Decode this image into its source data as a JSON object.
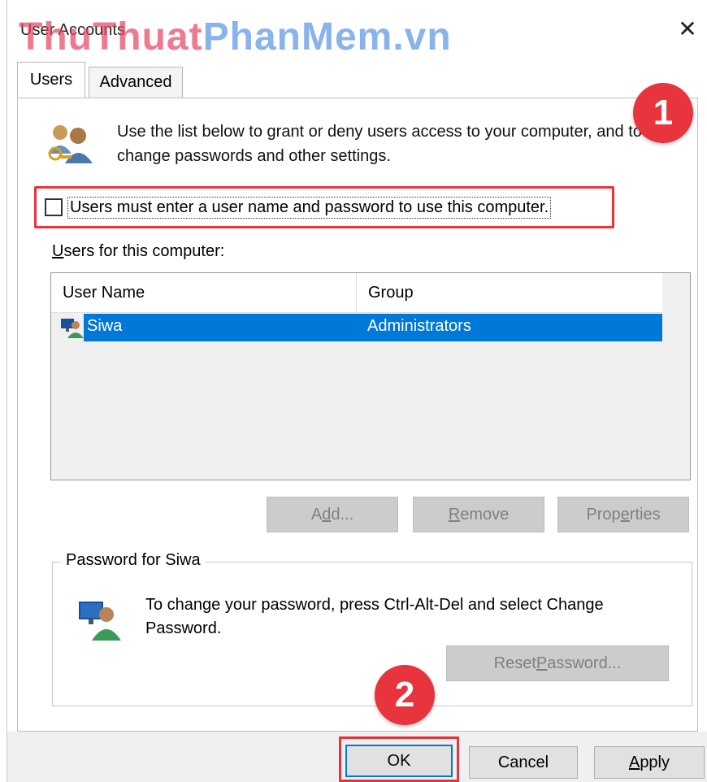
{
  "window": {
    "title": "User Accounts",
    "close_glyph": "✕",
    "watermark_part1": "ThuThuat",
    "watermark_part2": "PhanMem.vn"
  },
  "tabs": [
    {
      "label": "Users",
      "active": true
    },
    {
      "label": "Advanced",
      "active": false
    }
  ],
  "intro": {
    "icon": "users-keys-icon",
    "text": "Use the list below to grant or deny users access to your computer, and to change passwords and other settings."
  },
  "login_requirement": {
    "label": "Users must enter a user name and password to use this computer.",
    "checked": false
  },
  "annotations": {
    "badge_1": "1",
    "badge_2": "2",
    "highlight_color": "#e8323c"
  },
  "users_list": {
    "label_prefix": "U",
    "label_rest": "sers for this computer:",
    "columns": [
      "User Name",
      "Group"
    ],
    "rows": [
      {
        "user_name": "Siwa",
        "group": "Administrators",
        "selected": true,
        "icon": "user-monitor-icon"
      }
    ]
  },
  "list_buttons": {
    "add_prefix": "A",
    "add_underlined": "d",
    "add_rest": "d...",
    "remove_underlined": "R",
    "remove_rest": "emove",
    "properties_prefix": "Prop",
    "properties_underlined": "e",
    "properties_rest": "rties"
  },
  "password_group": {
    "title": "Password for Siwa",
    "icon": "user-monitor-icon",
    "text": "To change your password, press Ctrl-Alt-Del and select Change Password.",
    "reset_prefix": "Reset ",
    "reset_underlined": "P",
    "reset_rest": "assword..."
  },
  "footer": {
    "ok_label": "OK",
    "cancel_label": "Cancel",
    "apply_underlined": "A",
    "apply_rest": "pply"
  },
  "colors": {
    "selection": "#0078d7",
    "accent_red": "#e7343d",
    "disabled_button": "#cccccc"
  }
}
